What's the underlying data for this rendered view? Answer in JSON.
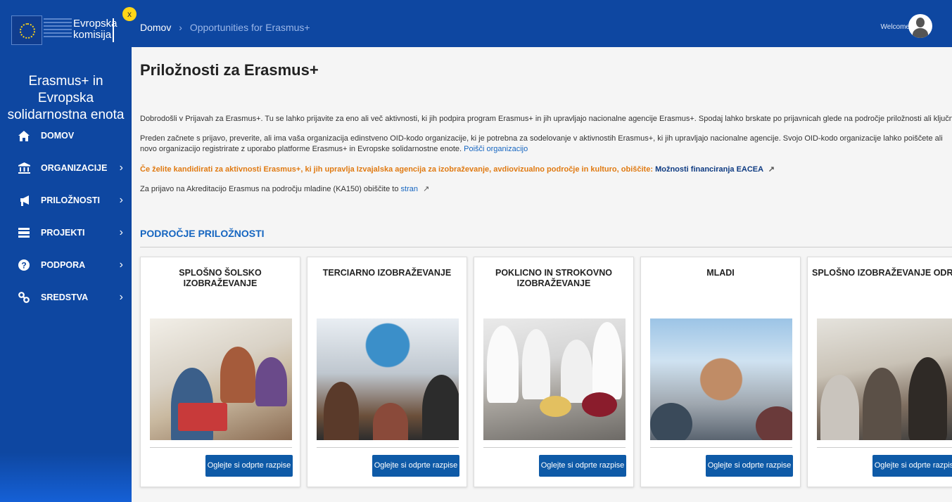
{
  "sidebar": {
    "logo_text_1": "Evropska",
    "logo_text_2": "komisija",
    "close_label": "x",
    "app_name": "Erasmus+ in Evropska solidarnostna enota",
    "items": [
      {
        "label": "DOMOV",
        "icon": "home-icon"
      },
      {
        "label": "ORGANIZACIJE",
        "icon": "institution-icon"
      },
      {
        "label": "PRILOŽNOSTI",
        "icon": "megaphone-icon"
      },
      {
        "label": "PROJEKTI",
        "icon": "projects-icon"
      },
      {
        "label": "PODPORA",
        "icon": "help-icon"
      },
      {
        "label": "SREDSTVA",
        "icon": "link-icon"
      }
    ]
  },
  "topbar": {
    "breadcrumb_home": "Domov",
    "breadcrumb_sep": "›",
    "breadcrumb_current": "Opportunities for Erasmus+",
    "welcome": "Welcome"
  },
  "main": {
    "title": "Priložnosti za Erasmus+",
    "p1": "Dobrodošli v Prijavah za Erasmus+. Tu se lahko prijavite za eno ali več aktivnosti, ki jih podpira program Erasmus+ in jih upravljajo nacionalne agencije Erasmus+. Spodaj lahko brskate po prijavnicah glede na področje priložnosti ali ključno aktivnost.",
    "p2_text": "Preden začnete s prijavo, preverite, ali ima vaša organizacija edinstveno OID-kodo organizacije, ki je potrebna za sodelovanje v aktivnostih Erasmus+, ki jih upravljajo nacionalne agencije. Svojo OID-kodo organizacije lahko poiščete ali novo organizacijo registrirate z uporabo platforme Erasmus+ in Evropske solidarnostne enote.",
    "p2_link": "Poišči organizacijo",
    "p3_text": "Če želite kandidirati za aktivnosti Erasmus+, ki jih upravlja Izvajalska agencija za izobraževanje, avdiovizualno področje in kulturo, obiščite:",
    "p3_link": "Možnosti financiranja EACEA",
    "p4_text": "Za prijavo na Akreditacijo Erasmus na področju mladine (KA150) obiščite to",
    "p4_link": "stran",
    "section_title": "PODROČJE PRILOŽNOSTI",
    "cards": [
      {
        "title": "SPLOŠNO ŠOLSKO IZOBRAŽEVANJE",
        "button": "Oglejte si odprte razpise"
      },
      {
        "title": "TERCIARNO IZOBRAŽEVANJE",
        "button": "Oglejte si odprte razpise"
      },
      {
        "title": "POKLICNO IN STROKOVNO IZOBRAŽEVANJE",
        "button": "Oglejte si odprte razpise"
      },
      {
        "title": "MLADI",
        "button": "Oglejte si odprte razpise"
      },
      {
        "title": "SPLOŠNO IZOBRAŽEVANJE ODRASLIH",
        "button": "Oglejte si odprte razpise"
      }
    ]
  },
  "colors": {
    "primary": "#0e47a1",
    "accent_orange": "#e07a12",
    "link": "#1565c0",
    "button": "#0e5aa7",
    "eu_gold": "#ffd617"
  }
}
